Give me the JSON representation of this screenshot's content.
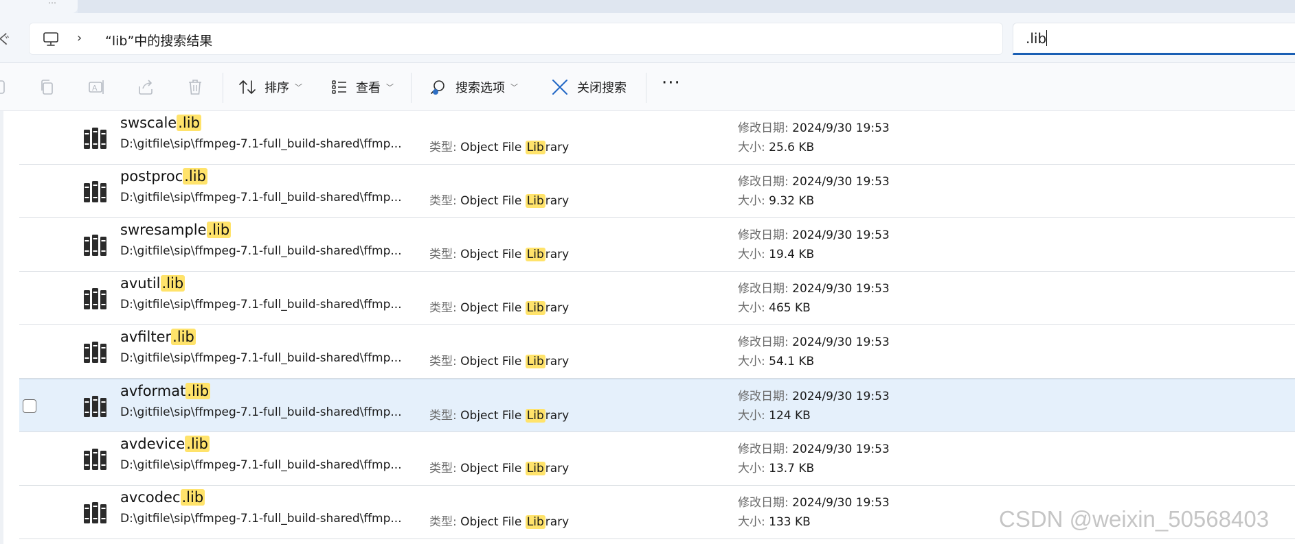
{
  "address": {
    "left_edge_glyph": "ぐ",
    "breadcrumb_chevron": "›",
    "breadcrumb": "“lib”中的搜索结果",
    "tab_fragment": "…"
  },
  "search": {
    "value": ".lib"
  },
  "toolbar": {
    "sort_label": "排序",
    "view_label": "查看",
    "search_options_label": "搜索选项",
    "close_search_label": "关闭搜索",
    "more_label": "···"
  },
  "labels": {
    "type": "类型:",
    "modified": "修改日期:",
    "size": "大小:",
    "type_value_prefix": "Object File ",
    "type_value_highlight": "Lib",
    "type_value_suffix": "rary",
    "name_highlight": ".lib"
  },
  "files": [
    {
      "base": "swscale",
      "path": "D:\\gitfile\\sip\\ffmpeg-7.1-full_build-shared\\ffmp...",
      "date": "2024/9/30 19:53",
      "size": "25.6 KB"
    },
    {
      "base": "postproc",
      "path": "D:\\gitfile\\sip\\ffmpeg-7.1-full_build-shared\\ffmp...",
      "date": "2024/9/30 19:53",
      "size": "9.32 KB"
    },
    {
      "base": "swresample",
      "path": "D:\\gitfile\\sip\\ffmpeg-7.1-full_build-shared\\ffmp...",
      "date": "2024/9/30 19:53",
      "size": "19.4 KB"
    },
    {
      "base": "avutil",
      "path": "D:\\gitfile\\sip\\ffmpeg-7.1-full_build-shared\\ffmp...",
      "date": "2024/9/30 19:53",
      "size": "465 KB"
    },
    {
      "base": "avfilter",
      "path": "D:\\gitfile\\sip\\ffmpeg-7.1-full_build-shared\\ffmp...",
      "date": "2024/9/30 19:53",
      "size": "54.1 KB"
    },
    {
      "base": "avformat",
      "path": "D:\\gitfile\\sip\\ffmpeg-7.1-full_build-shared\\ffmp...",
      "date": "2024/9/30 19:53",
      "size": "124 KB"
    },
    {
      "base": "avdevice",
      "path": "D:\\gitfile\\sip\\ffmpeg-7.1-full_build-shared\\ffmp...",
      "date": "2024/9/30 19:53",
      "size": "13.7 KB"
    },
    {
      "base": "avcodec",
      "path": "D:\\gitfile\\sip\\ffmpeg-7.1-full_build-shared\\ffmp...",
      "date": "2024/9/30 19:53",
      "size": "133 KB"
    }
  ],
  "selected_index": 5,
  "watermark": "CSDN @weixin_50568403",
  "colors": {
    "highlight": "#ffe36b",
    "selection": "#e5f0fb",
    "search_underline": "#1a5fb4"
  },
  "icons": {
    "pc": "computer-icon",
    "file": "library-file-icon",
    "sort": "sort-arrows-icon",
    "view": "view-list-icon",
    "search_options": "search-options-icon",
    "close_search": "close-icon"
  }
}
